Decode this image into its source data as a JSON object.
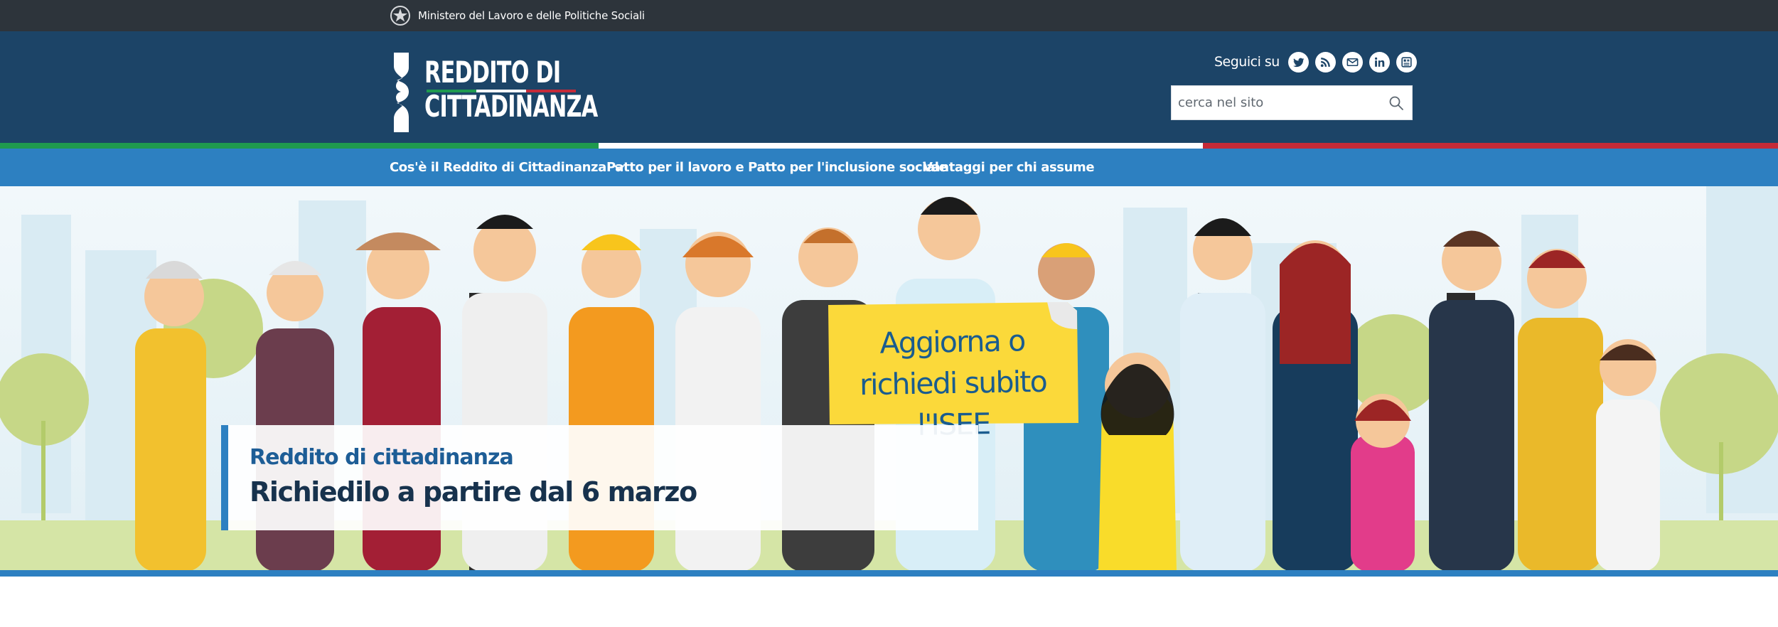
{
  "topbar": {
    "ministry_name": "Ministero del Lavoro e delle Politiche Sociali"
  },
  "header": {
    "logo_line1": "REDDITO DI",
    "logo_line2": "CITTADINANZA",
    "follow_label": "Seguici su",
    "social_icons": [
      "twitter-icon",
      "rss-icon",
      "mail-icon",
      "linkedin-icon",
      "newsletter-icon"
    ],
    "search": {
      "placeholder": "cerca nel sito"
    }
  },
  "flag_colors": {
    "green": "#1f9a4e",
    "white": "#ffffff",
    "red": "#c52a38"
  },
  "nav": {
    "items": [
      {
        "label": "Cos'è il Reddito di Cittadinanza",
        "has_dropdown": true
      },
      {
        "label": "Patto per il lavoro e Patto per l'inclusione sociale"
      },
      {
        "label": "Vantaggi per chi assume"
      }
    ]
  },
  "hero": {
    "sign_text_line1": "Aggiorna o",
    "sign_text_line2": "richiedi subito l'ISEE",
    "kicker": "Reddito di cittadinanza",
    "title": "Richiedilo a partire dal 6 marzo"
  },
  "colors": {
    "topbar": "#2d343b",
    "header": "#1c4467",
    "nav": "#2d80c1",
    "accent": "#1d5d96",
    "title": "#17324d",
    "sign": "#fbd93a"
  }
}
